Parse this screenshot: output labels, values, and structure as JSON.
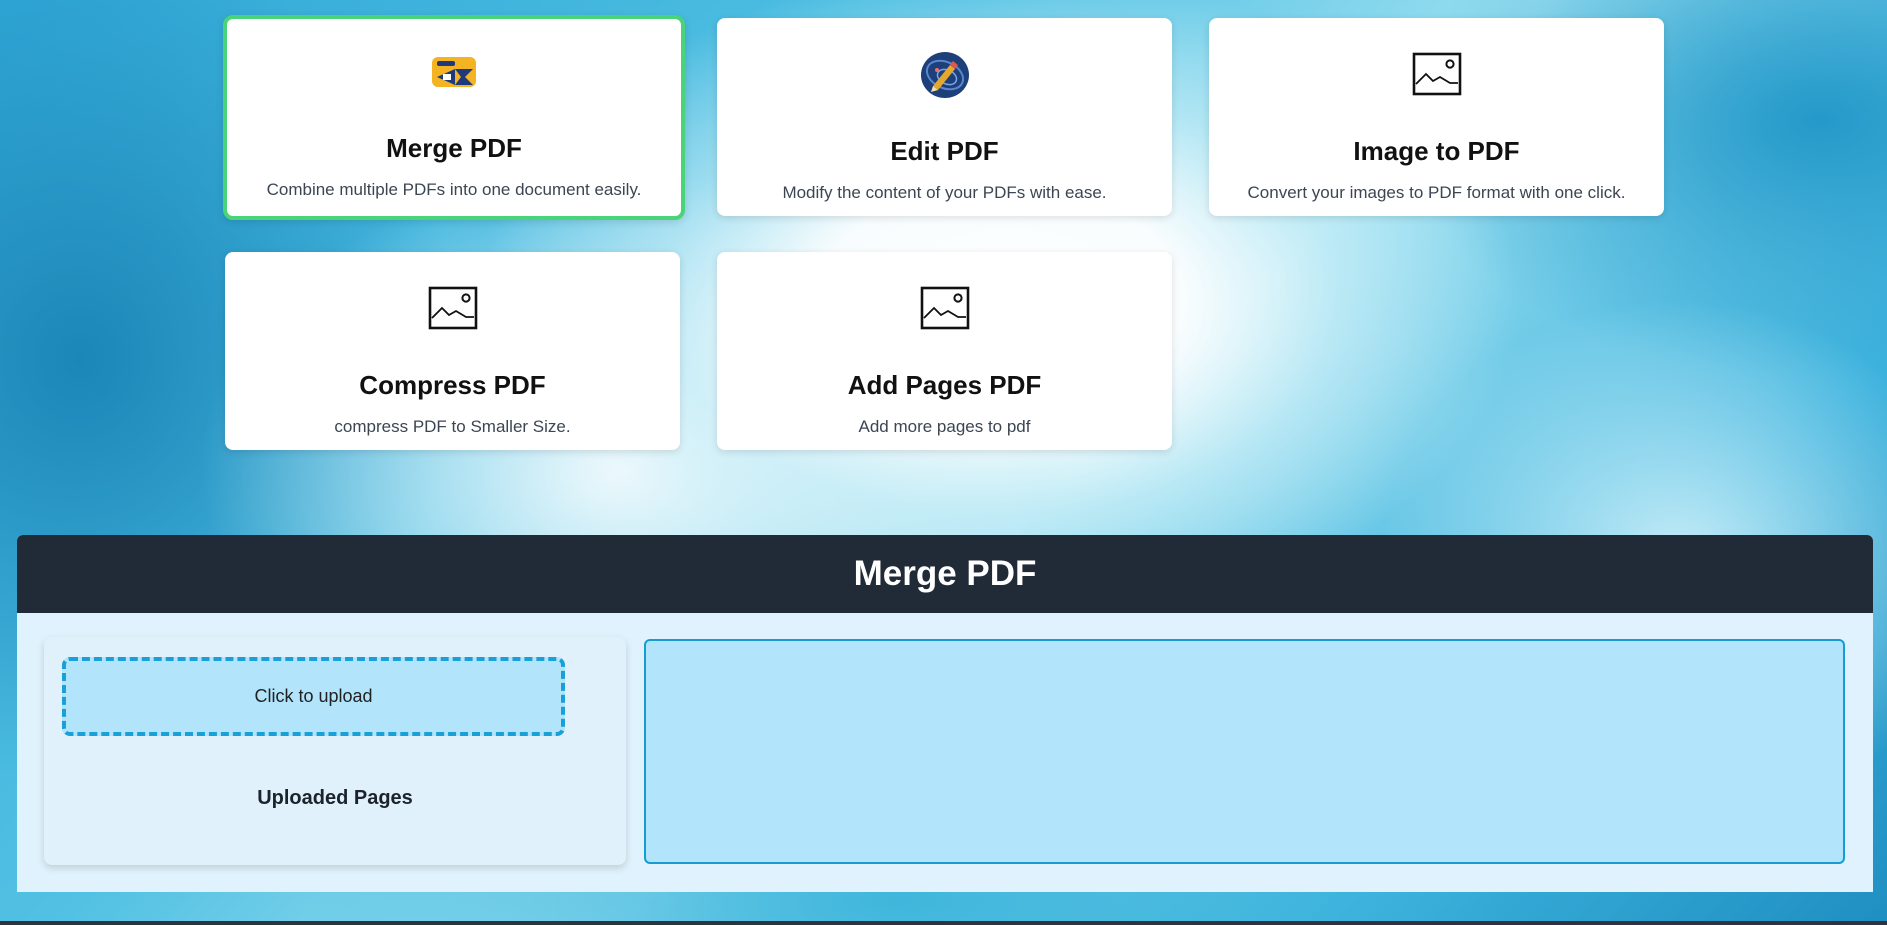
{
  "tools": [
    {
      "title": "Merge PDF",
      "description": "Combine multiple PDFs into one document easily.",
      "icon": "merge-icon",
      "active": true
    },
    {
      "title": "Edit PDF",
      "description": "Modify the content of your PDFs with ease.",
      "icon": "edit-icon",
      "active": false
    },
    {
      "title": "Image to PDF",
      "description": "Convert your images to PDF format with one click.",
      "icon": "image-icon",
      "active": false
    },
    {
      "title": "Compress PDF",
      "description": "compress PDF to Smaller Size.",
      "icon": "image-icon",
      "active": false
    },
    {
      "title": "Add Pages PDF",
      "description": "Add more pages to pdf",
      "icon": "image-icon",
      "active": false
    }
  ],
  "panel": {
    "title": "Merge PDF",
    "upload_label": "Click to upload",
    "uploaded_heading": "Uploaded Pages"
  },
  "colors": {
    "active_border": "#4ad479",
    "panel_header": "#212a37",
    "upload_border": "#1aa0d8",
    "preview_fill": "#b2e4fb"
  }
}
